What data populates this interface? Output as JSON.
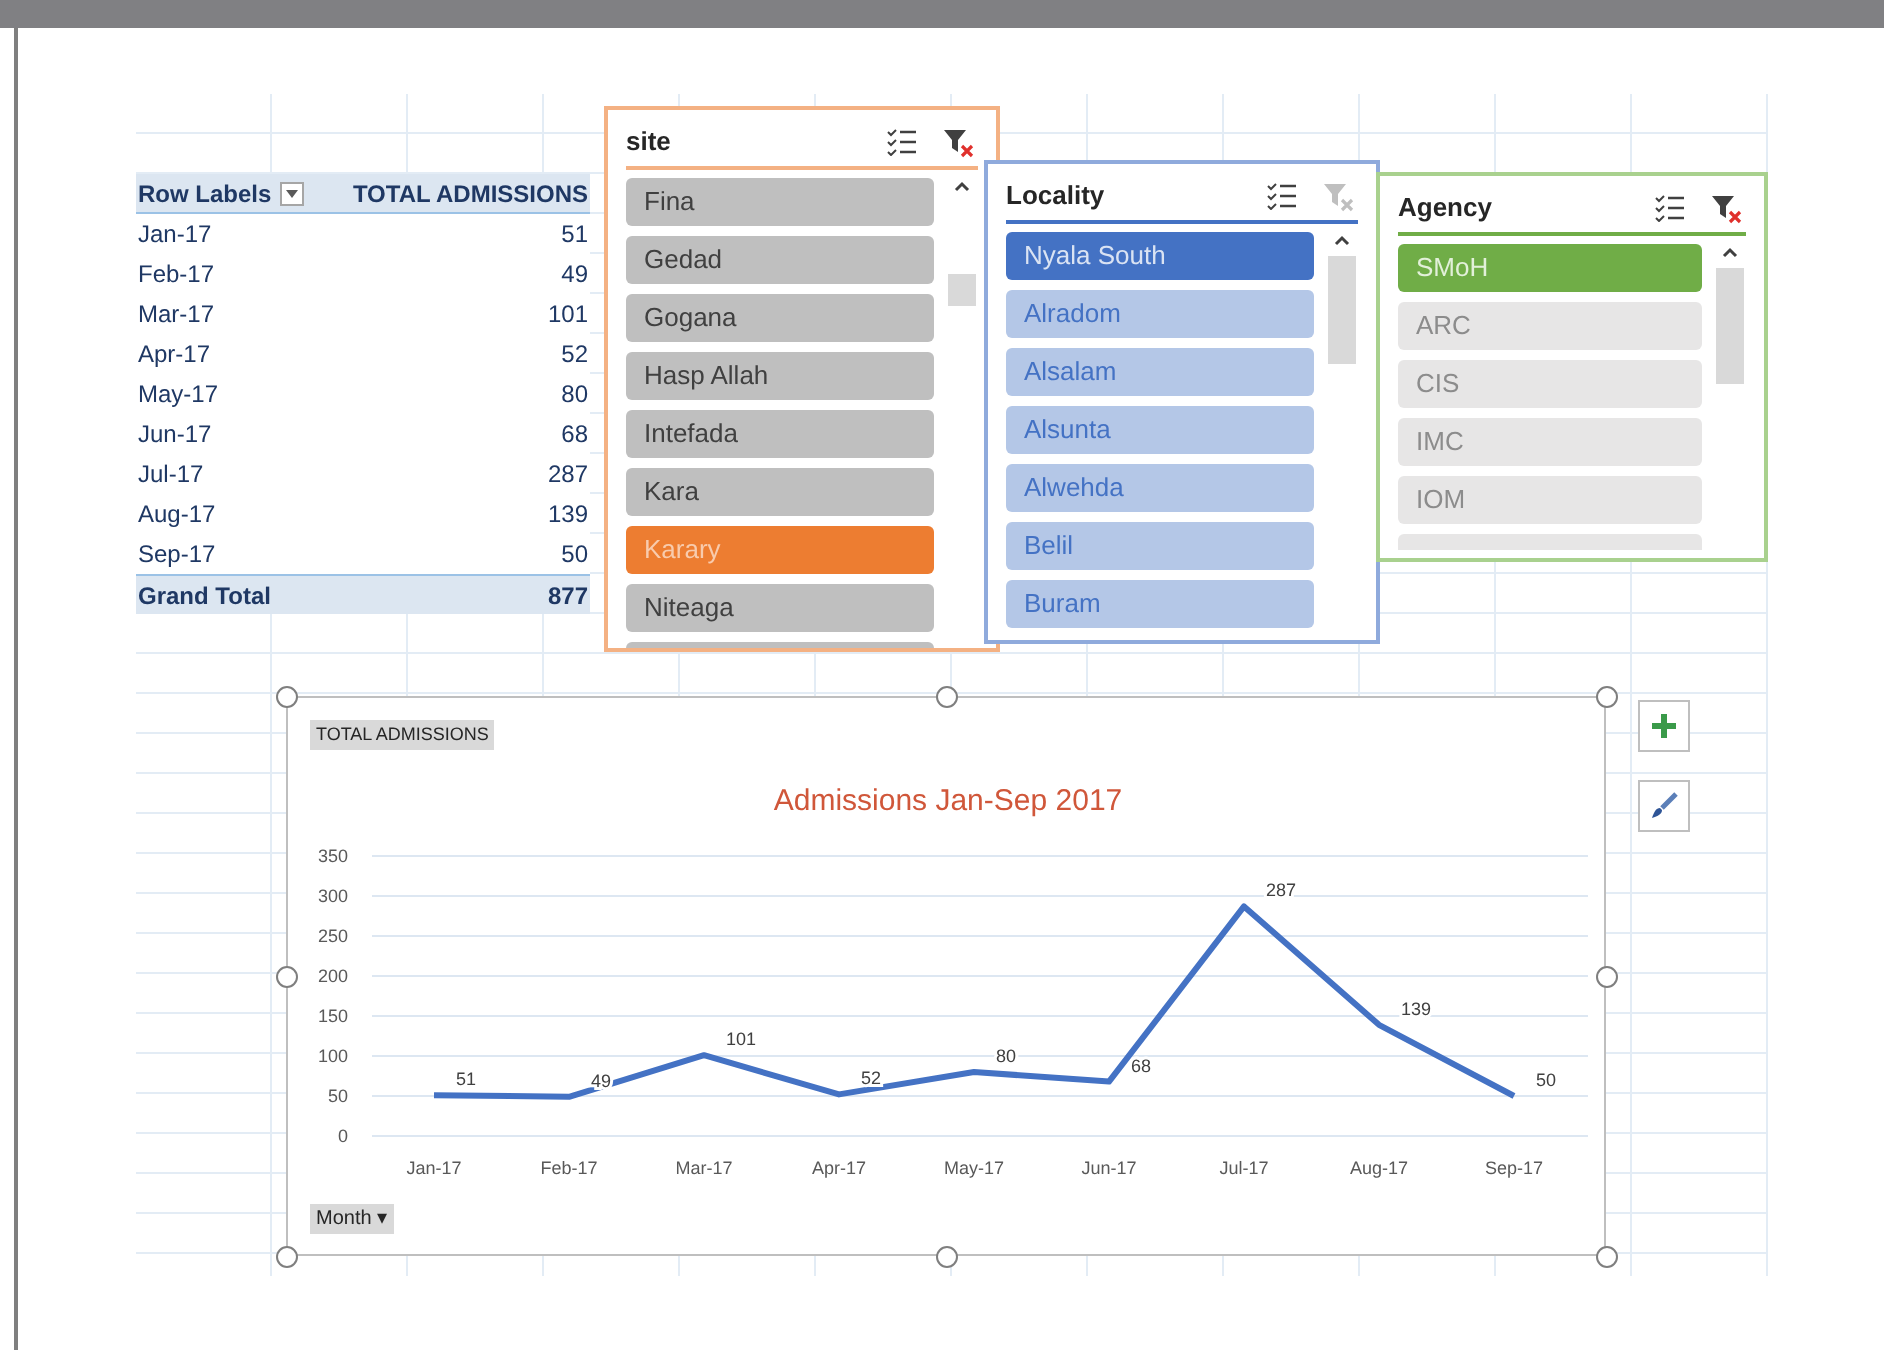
{
  "pivot": {
    "header": {
      "row_labels": "Row Labels",
      "value": "TOTAL ADMISSIONS"
    },
    "rows": [
      {
        "label": "Jan-17",
        "value": "51"
      },
      {
        "label": "Feb-17",
        "value": "49"
      },
      {
        "label": "Mar-17",
        "value": "101"
      },
      {
        "label": "Apr-17",
        "value": "52"
      },
      {
        "label": "May-17",
        "value": "80"
      },
      {
        "label": "Jun-17",
        "value": "68"
      },
      {
        "label": "Jul-17",
        "value": "287"
      },
      {
        "label": "Aug-17",
        "value": "139"
      },
      {
        "label": "Sep-17",
        "value": "50"
      }
    ],
    "total": {
      "label": "Grand Total",
      "value": "877"
    }
  },
  "slicers": [
    {
      "title": "site",
      "kind": "orange",
      "clear_filter_disabled": false,
      "more_below": true,
      "items": [
        {
          "label": "Fina",
          "selected": false
        },
        {
          "label": "Gedad",
          "selected": false
        },
        {
          "label": "Gogana",
          "selected": false
        },
        {
          "label": "Hasp Allah",
          "selected": false
        },
        {
          "label": "Intefada",
          "selected": false
        },
        {
          "label": "Kara",
          "selected": false
        },
        {
          "label": "Karary",
          "selected": true
        },
        {
          "label": "Niteaga",
          "selected": false
        }
      ]
    },
    {
      "title": "Locality",
      "kind": "blue",
      "clear_filter_disabled": true,
      "more_below": false,
      "items": [
        {
          "label": "Nyala South",
          "selected": true
        },
        {
          "label": "Alradom",
          "selected": false
        },
        {
          "label": "Alsalam",
          "selected": false
        },
        {
          "label": "Alsunta",
          "selected": false
        },
        {
          "label": "Alwehda",
          "selected": false
        },
        {
          "label": "Belil",
          "selected": false
        },
        {
          "label": "Buram",
          "selected": false
        }
      ]
    },
    {
      "title": "Agency",
      "kind": "green",
      "clear_filter_disabled": false,
      "more_below": true,
      "items": [
        {
          "label": "SMoH",
          "selected": true
        },
        {
          "label": "ARC",
          "selected": false
        },
        {
          "label": "CIS",
          "selected": false
        },
        {
          "label": "IMC",
          "selected": false
        },
        {
          "label": "IOM",
          "selected": false
        }
      ]
    }
  ],
  "chart": {
    "axis_button": "Month ▾",
    "chart_data": {
      "type": "line",
      "title": "Admissions Jan-Sep 2017",
      "categories": [
        "Jan-17",
        "Feb-17",
        "Mar-17",
        "Apr-17",
        "May-17",
        "Jun-17",
        "Jul-17",
        "Aug-17",
        "Sep-17"
      ],
      "series": [
        {
          "name": "TOTAL ADMISSIONS",
          "color": "#4472c4",
          "values": [
            51,
            49,
            101,
            52,
            80,
            68,
            287,
            139,
            50
          ]
        }
      ],
      "ylim": [
        0,
        350
      ],
      "grid": true,
      "yticks": [
        0,
        50,
        100,
        150,
        200,
        250,
        300,
        350
      ],
      "data_labels": true
    }
  }
}
